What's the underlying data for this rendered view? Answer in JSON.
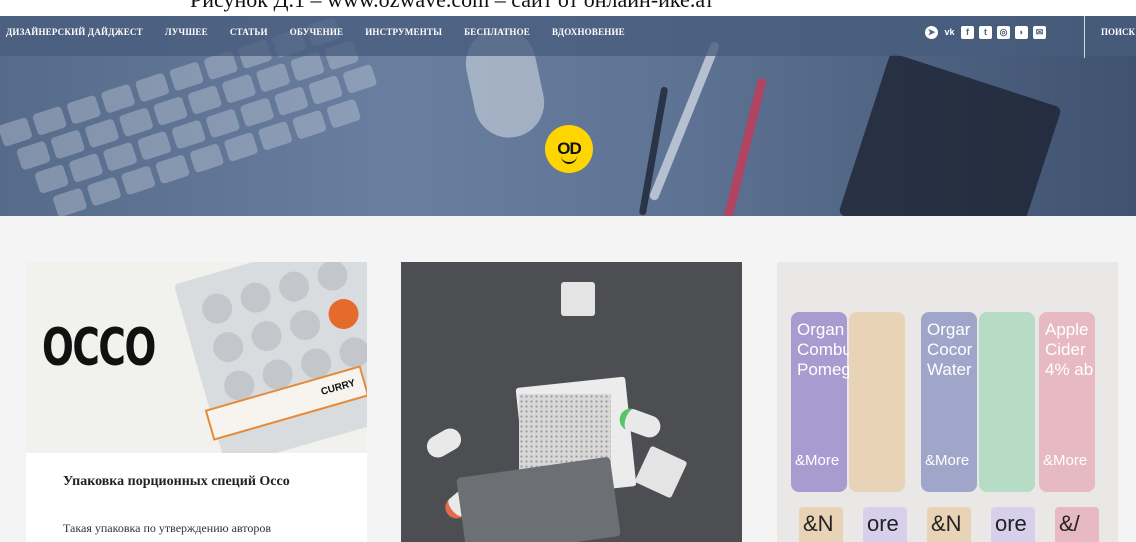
{
  "caption": {
    "text": "Рисунок Д.1 – www.ozwave.com – сайт от онлайн-ике.ат"
  },
  "nav": {
    "items": [
      "ДИЗАЙНЕРСКИЙ ДАЙДЖЕСТ",
      "ЛУЧШЕЕ",
      "СТАТЬИ",
      "ОБУЧЕНИЕ",
      "ИНСТРУМЕНТЫ",
      "БЕСПЛАТНОЕ",
      "ВДОХНОВЕНИЕ"
    ],
    "social_icons": [
      "telegram-icon",
      "vk-icon",
      "facebook-icon",
      "twitter-icon",
      "instagram-icon",
      "rss-icon",
      "mail-icon"
    ],
    "search_label": "ПОИСК"
  },
  "hero": {
    "logo_text": "OD"
  },
  "cards": [
    {
      "image_brand": "OCCO",
      "image_label": "CURRY",
      "title": "Упаковка порционных специй Occo",
      "excerpt": "Такая упаковка по утверждению авторов"
    },
    {
      "image_description": "product"
    },
    {
      "cans": [
        "Organ\nCombu\nPomeg",
        "",
        "Orgar\nCocor\nWater",
        "",
        "Apple\nCider\n4% ab"
      ],
      "brand": "&More",
      "cup_labels": [
        "&N",
        "ore",
        "&N",
        "ore",
        "&/"
      ]
    }
  ],
  "colors": {
    "accent": "#ffd500",
    "nav_bg": "#485c7c",
    "page_bg": "#f4f4f4"
  }
}
